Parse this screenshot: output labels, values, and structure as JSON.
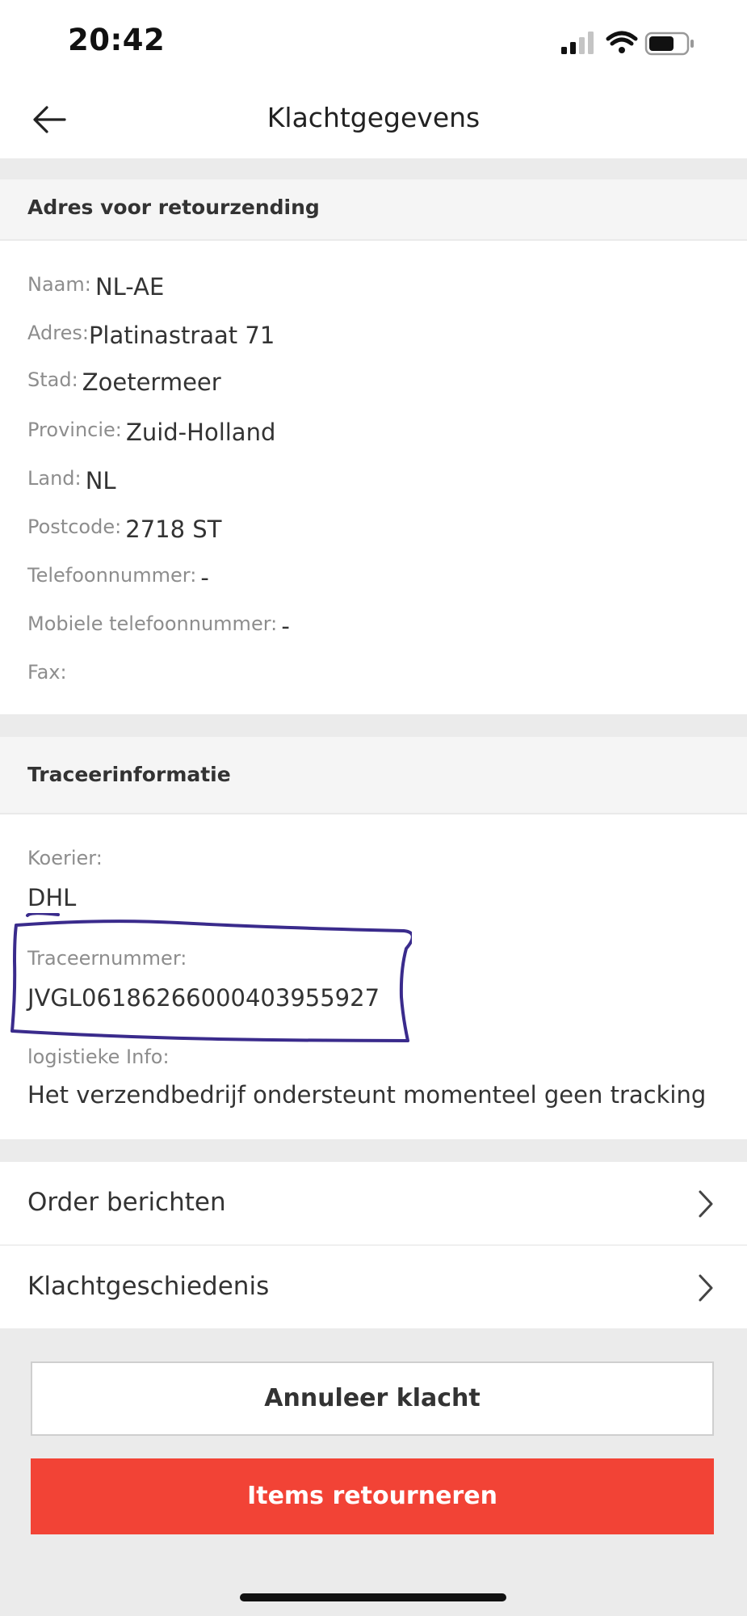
{
  "status_bar": {
    "time": "20:42"
  },
  "header": {
    "title": "Klachtgegevens"
  },
  "return_address": {
    "section_title": "Adres voor retourzending",
    "fields": [
      {
        "label": "Naam:",
        "value": "NL-AE"
      },
      {
        "label": "Adres:",
        "value": "Platinastraat 71"
      },
      {
        "label": "Stad:",
        "value": "Zoetermeer"
      },
      {
        "label": "Provincie:",
        "value": "Zuid-Holland"
      },
      {
        "label": "Land:",
        "value": "NL"
      },
      {
        "label": "Postcode:",
        "value": "2718 ST"
      },
      {
        "label": "Telefoonnummer:",
        "value": "-"
      },
      {
        "label": "Mobiele telefoonnummer:",
        "value": "-"
      },
      {
        "label": "Fax:",
        "value": ""
      }
    ]
  },
  "tracking": {
    "section_title": "Traceerinformatie",
    "courier_label": "Koerier:",
    "courier_value": "DHL",
    "tracking_label": "Traceernummer:",
    "tracking_value": "JVGL06186266000403955927",
    "logistics_label": "logistieke Info:",
    "logistics_value": "Het verzendbedrijf ondersteunt momenteel geen tracking",
    "highlight_color": "#3a2b8c"
  },
  "menu": {
    "order_messages": "Order berichten",
    "complaint_history": "Klachtgeschiedenis"
  },
  "buttons": {
    "cancel_complaint": "Annuleer klacht",
    "return_items": "Items retourneren",
    "primary_color": "#f24336"
  }
}
